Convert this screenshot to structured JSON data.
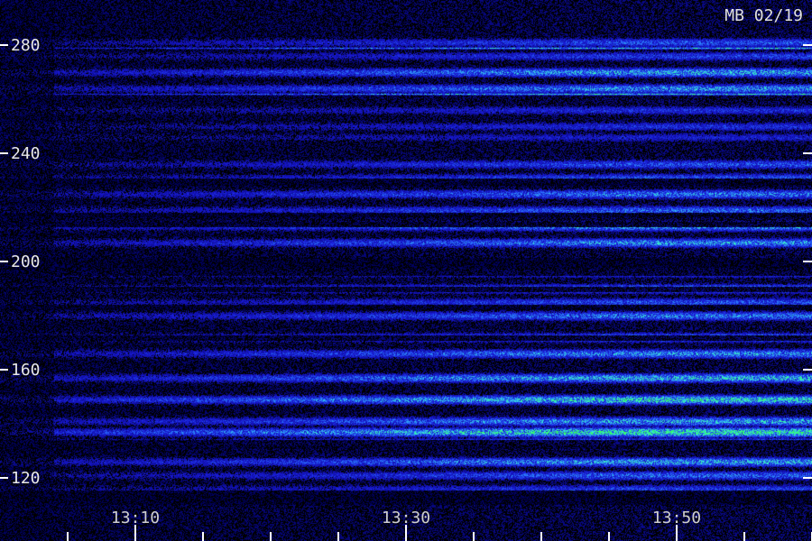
{
  "chart_data": {
    "type": "heatmap",
    "annotation": "MB 02/19",
    "yticks": [
      280,
      240,
      200,
      160,
      120
    ],
    "xtick_labels": [
      "13:10",
      "13:30",
      "13:50"
    ],
    "ylim": [
      112,
      298
    ],
    "grid": false,
    "colors": {
      "background": "#000000",
      "low": "#1a1ad8",
      "mid": "#2a7cff",
      "high": "#38f0d0",
      "peak": "#33ff5a"
    },
    "bands": [
      {
        "freq": 281,
        "intensity": 0.55
      },
      {
        "freq": 279,
        "intensity": 0.85,
        "narrow": true
      },
      {
        "freq": 276,
        "intensity": 0.5
      },
      {
        "freq": 270,
        "intensity": 0.75
      },
      {
        "freq": 264,
        "intensity": 0.7
      },
      {
        "freq": 262,
        "intensity": 0.9,
        "narrow": true
      },
      {
        "freq": 256,
        "intensity": 0.45
      },
      {
        "freq": 250,
        "intensity": 0.45
      },
      {
        "freq": 246,
        "intensity": 0.4
      },
      {
        "freq": 236,
        "intensity": 0.55
      },
      {
        "freq": 231,
        "intensity": 0.55
      },
      {
        "freq": 225,
        "intensity": 0.65
      },
      {
        "freq": 219,
        "intensity": 0.6
      },
      {
        "freq": 213,
        "intensity": 0.7
      },
      {
        "freq": 207,
        "intensity": 0.7
      },
      {
        "freq": 196,
        "intensity": 0.65
      },
      {
        "freq": 190,
        "intensity": 0.7
      },
      {
        "freq": 185,
        "intensity": 0.55
      },
      {
        "freq": 180,
        "intensity": 0.65
      },
      {
        "freq": 172,
        "intensity": 0.7
      },
      {
        "freq": 166,
        "intensity": 0.7
      },
      {
        "freq": 157,
        "intensity": 0.8
      },
      {
        "freq": 149,
        "intensity": 0.9
      },
      {
        "freq": 141,
        "intensity": 0.75
      },
      {
        "freq": 137,
        "intensity": 1.0
      },
      {
        "freq": 133,
        "intensity": 0.85
      },
      {
        "freq": 126,
        "intensity": 0.75
      },
      {
        "freq": 121,
        "intensity": 0.6
      },
      {
        "freq": 116,
        "intensity": 0.5
      }
    ]
  }
}
